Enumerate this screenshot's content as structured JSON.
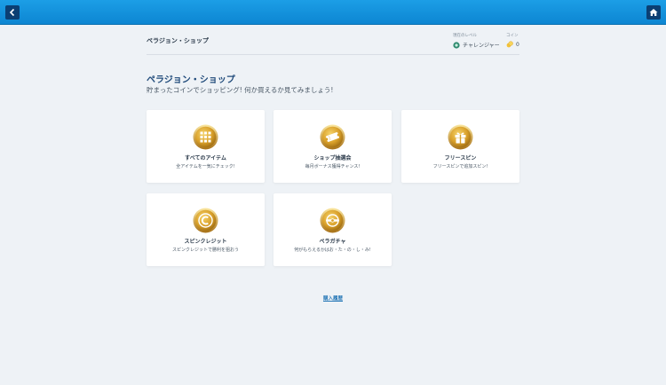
{
  "header": {
    "breadcrumb": "ペラジョン・ショップ",
    "level_caption": "現在のレベル",
    "level_value": "チャレンジャー",
    "coin_caption": "コイン",
    "coin_value": "0"
  },
  "main": {
    "title": "ペラジョン・ショップ",
    "subtitle": "貯まったコインでショッピング! 何か買えるか見てみましょう!"
  },
  "cards": [
    {
      "name": "すべてのアイテム",
      "desc": "全アイテムを一気にチェック!",
      "icon": "grid-icon"
    },
    {
      "name": "ショップ抽選会",
      "desc": "毎月ボーナス獲得チャンス!",
      "icon": "ticket-icon"
    },
    {
      "name": "フリースピン",
      "desc": "フリースピンで追加スピン!",
      "icon": "gift-icon"
    },
    {
      "name": "スピンクレジット",
      "desc": "スピンクレジットで勝利を狙おう",
      "icon": "credit-icon"
    },
    {
      "name": "ペラガチャ",
      "desc": "何がもらえるかはお・た・の・し・み!",
      "icon": "capsule-icon"
    }
  ],
  "footer": {
    "history_link": "購入履歴"
  },
  "colors": {
    "topbar": "#0d86d2",
    "nav_button": "#0b3f73",
    "title": "#1f4a7a",
    "link": "#2a7ab8",
    "medal_gold": "#c8901c"
  }
}
